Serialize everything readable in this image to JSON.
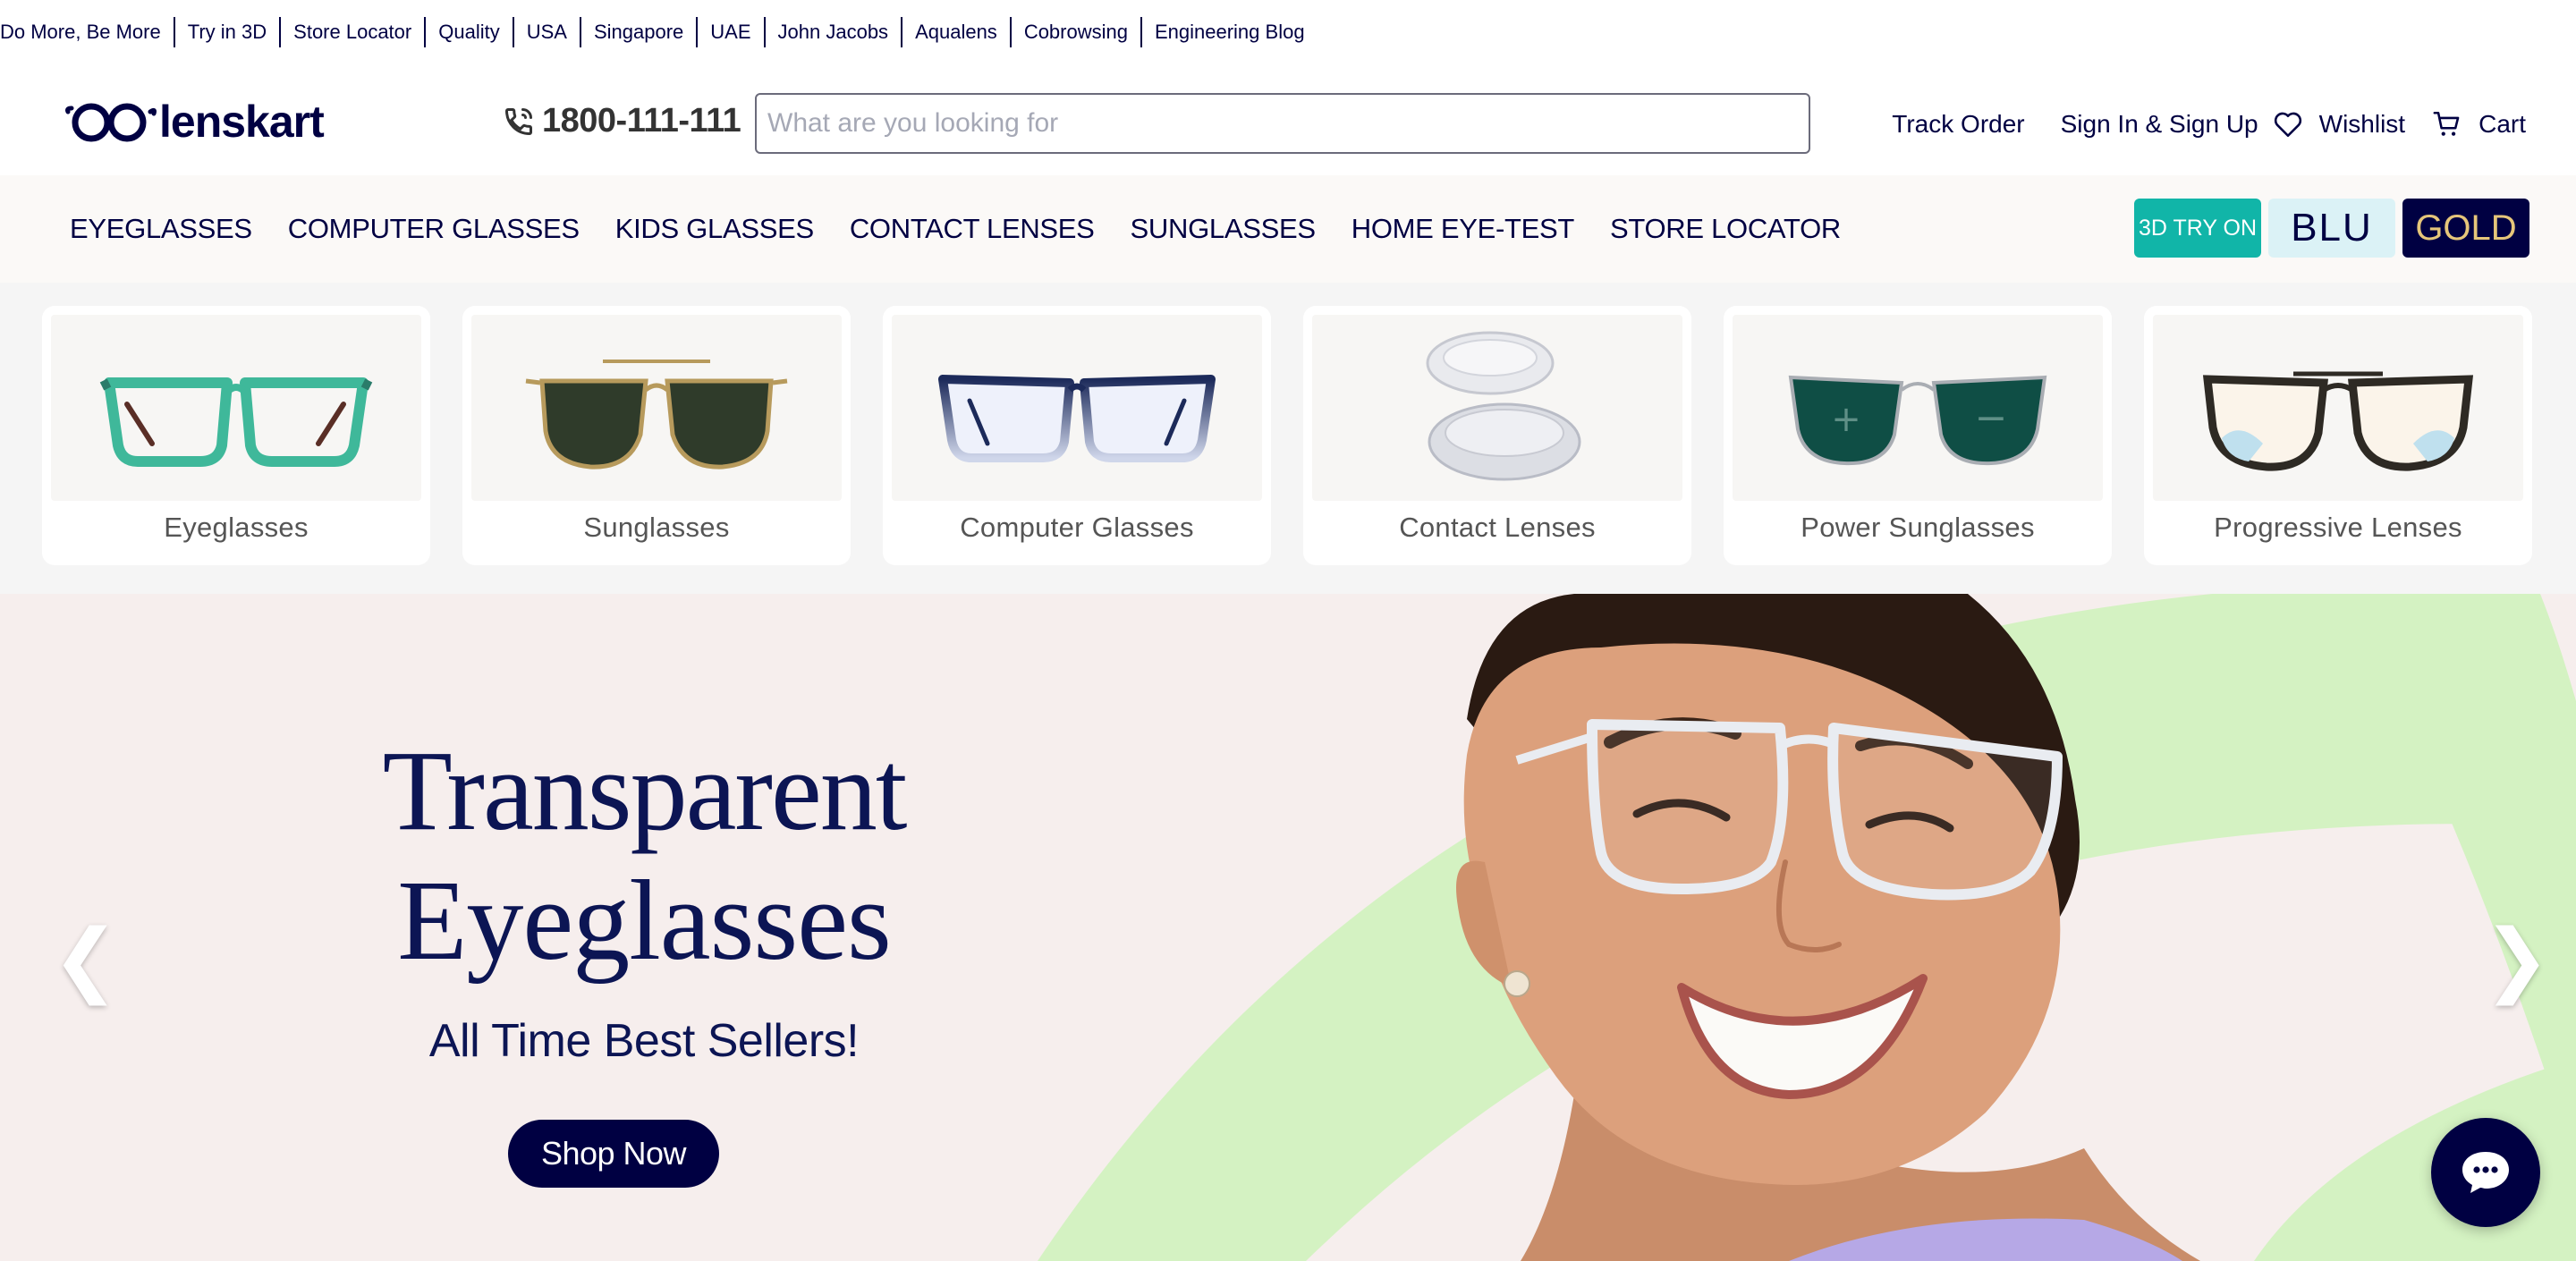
{
  "utility_links": [
    "Do More, Be More",
    "Try in 3D",
    "Store Locator",
    "Quality",
    "USA",
    "Singapore",
    "UAE",
    "John Jacobs",
    "Aqualens",
    "Cobrowsing",
    "Engineering Blog"
  ],
  "header": {
    "brand": "lenskart",
    "phone": "1800-111-111",
    "search_placeholder": "What are you looking for",
    "track_order": "Track Order",
    "sign_in": "Sign In & Sign Up",
    "wishlist": "Wishlist",
    "cart": "Cart"
  },
  "nav": {
    "items": [
      "EYEGLASSES",
      "COMPUTER GLASSES",
      "KIDS GLASSES",
      "CONTACT LENSES",
      "SUNGLASSES",
      "HOME EYE-TEST",
      "STORE LOCATOR"
    ],
    "btn_3d": "3D TRY ON",
    "btn_blu": "BLU",
    "btn_gold": "GOLD"
  },
  "categories": [
    {
      "label": "Eyeglasses",
      "icon": "eyeglasses-icon"
    },
    {
      "label": "Sunglasses",
      "icon": "sunglasses-icon"
    },
    {
      "label": "Computer Glasses",
      "icon": "computer-glasses-icon"
    },
    {
      "label": "Contact Lenses",
      "icon": "contact-lenses-icon"
    },
    {
      "label": "Power Sunglasses",
      "icon": "power-sunglasses-icon"
    },
    {
      "label": "Progressive Lenses",
      "icon": "progressive-lenses-icon"
    }
  ],
  "hero": {
    "title_line1": "Transparent",
    "title_line2": "Eyeglasses",
    "subtitle": "All Time Best Sellers!",
    "cta": "Shop Now",
    "prev": "❮",
    "next": "❯"
  },
  "colors": {
    "navy": "#000042",
    "teal": "#11b5a8",
    "hero_bg": "#f6eeed",
    "hero_green": "#d4f2c2"
  }
}
